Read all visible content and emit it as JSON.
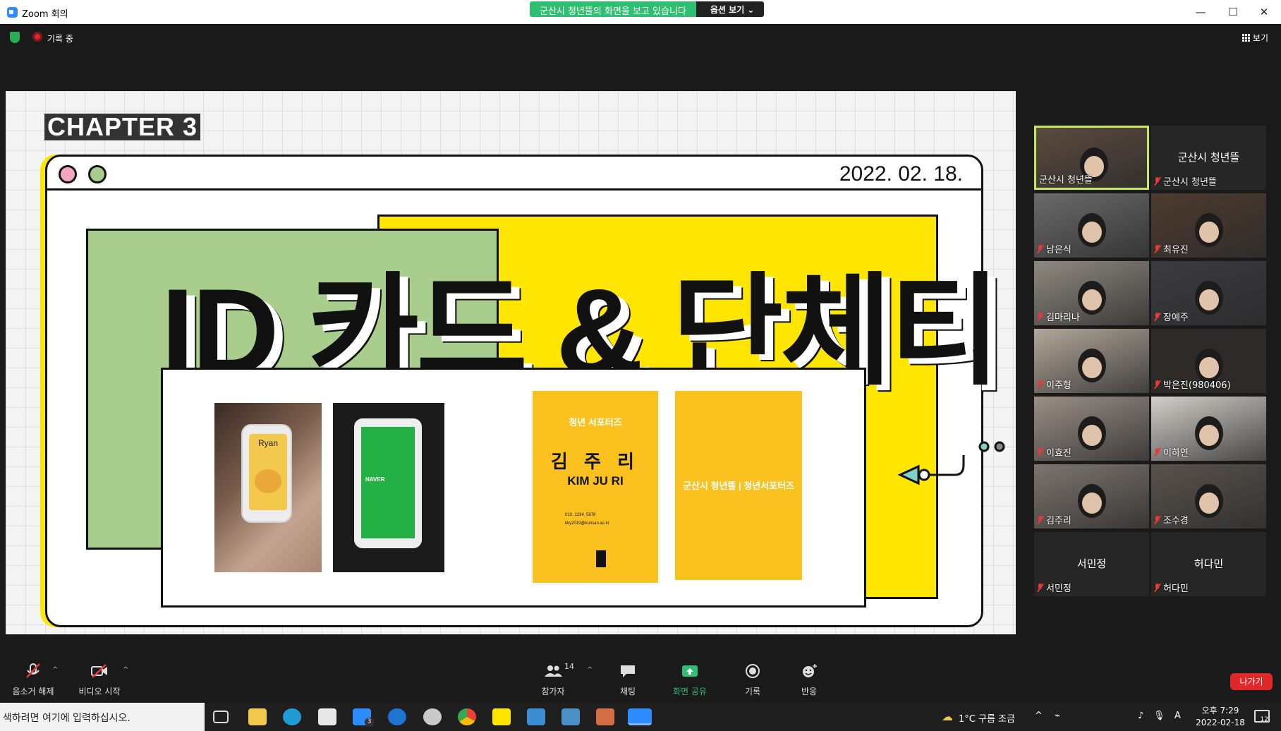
{
  "window": {
    "title": "Zoom 회의",
    "min_glyph": "—",
    "max_glyph": "☐",
    "close_glyph": "✕"
  },
  "share_banner": {
    "message": "군산시 청년뜰의 화면을 보고 있습니다",
    "options_label": "옵션 보기 ⌄"
  },
  "top": {
    "recording_label": "기록 중",
    "view_label": "보기"
  },
  "slide": {
    "chapter": "CHAPTER 3",
    "date": "2022. 02. 18.",
    "headline": "ID 카드 & 단체티",
    "photo1_label": "Ryan",
    "photo2_label": "NAVER",
    "namecard": {
      "top": "청년 서포터즈",
      "name_kr": "김 주 리",
      "name_en": "KIM JU RI",
      "phone": "010. 1234. 5678",
      "email": "kky2019@kunsan.ac.kr"
    },
    "namecard_back": "군산시 청년뜰 | 청년서포터즈"
  },
  "participants": [
    {
      "name": "군산시 청년뜰",
      "video": true,
      "active": true
    },
    {
      "name": "군산시 청년뜰",
      "video": false,
      "center": "군산시 청년뜰"
    },
    {
      "name": "남은식",
      "video": true
    },
    {
      "name": "최유진",
      "video": true
    },
    {
      "name": "김마리나",
      "video": true
    },
    {
      "name": "장예주",
      "video": true
    },
    {
      "name": "이주형",
      "video": true
    },
    {
      "name": "박은진(980406)",
      "video": true
    },
    {
      "name": "이효진",
      "video": true
    },
    {
      "name": "이하연",
      "video": true
    },
    {
      "name": "김주리",
      "video": true
    },
    {
      "name": "조수경",
      "video": true
    },
    {
      "name": "서민정",
      "video": false,
      "center": "서민정"
    },
    {
      "name": "허다민",
      "video": false,
      "center": "허다민"
    }
  ],
  "toolbar": {
    "mute": "음소거 해제",
    "video": "비디오 시작",
    "participants": "참가자",
    "participants_count": "14",
    "chat": "채팅",
    "share": "화면 공유",
    "record": "기록",
    "reactions": "반응",
    "leave": "나가기"
  },
  "taskbar": {
    "search_placeholder": "색하려면 여기에 입력하십시오.",
    "weather": "1°C 구름 조금",
    "time": "오후 7:29",
    "date": "2022-02-18",
    "notifications": "12",
    "mail_badge": "3",
    "ime": "A"
  },
  "colors": {
    "accent_green": "#2fbf71",
    "leave_red": "#e02828",
    "slide_yellow": "#ffe600",
    "slide_green": "#a8cd8c"
  }
}
